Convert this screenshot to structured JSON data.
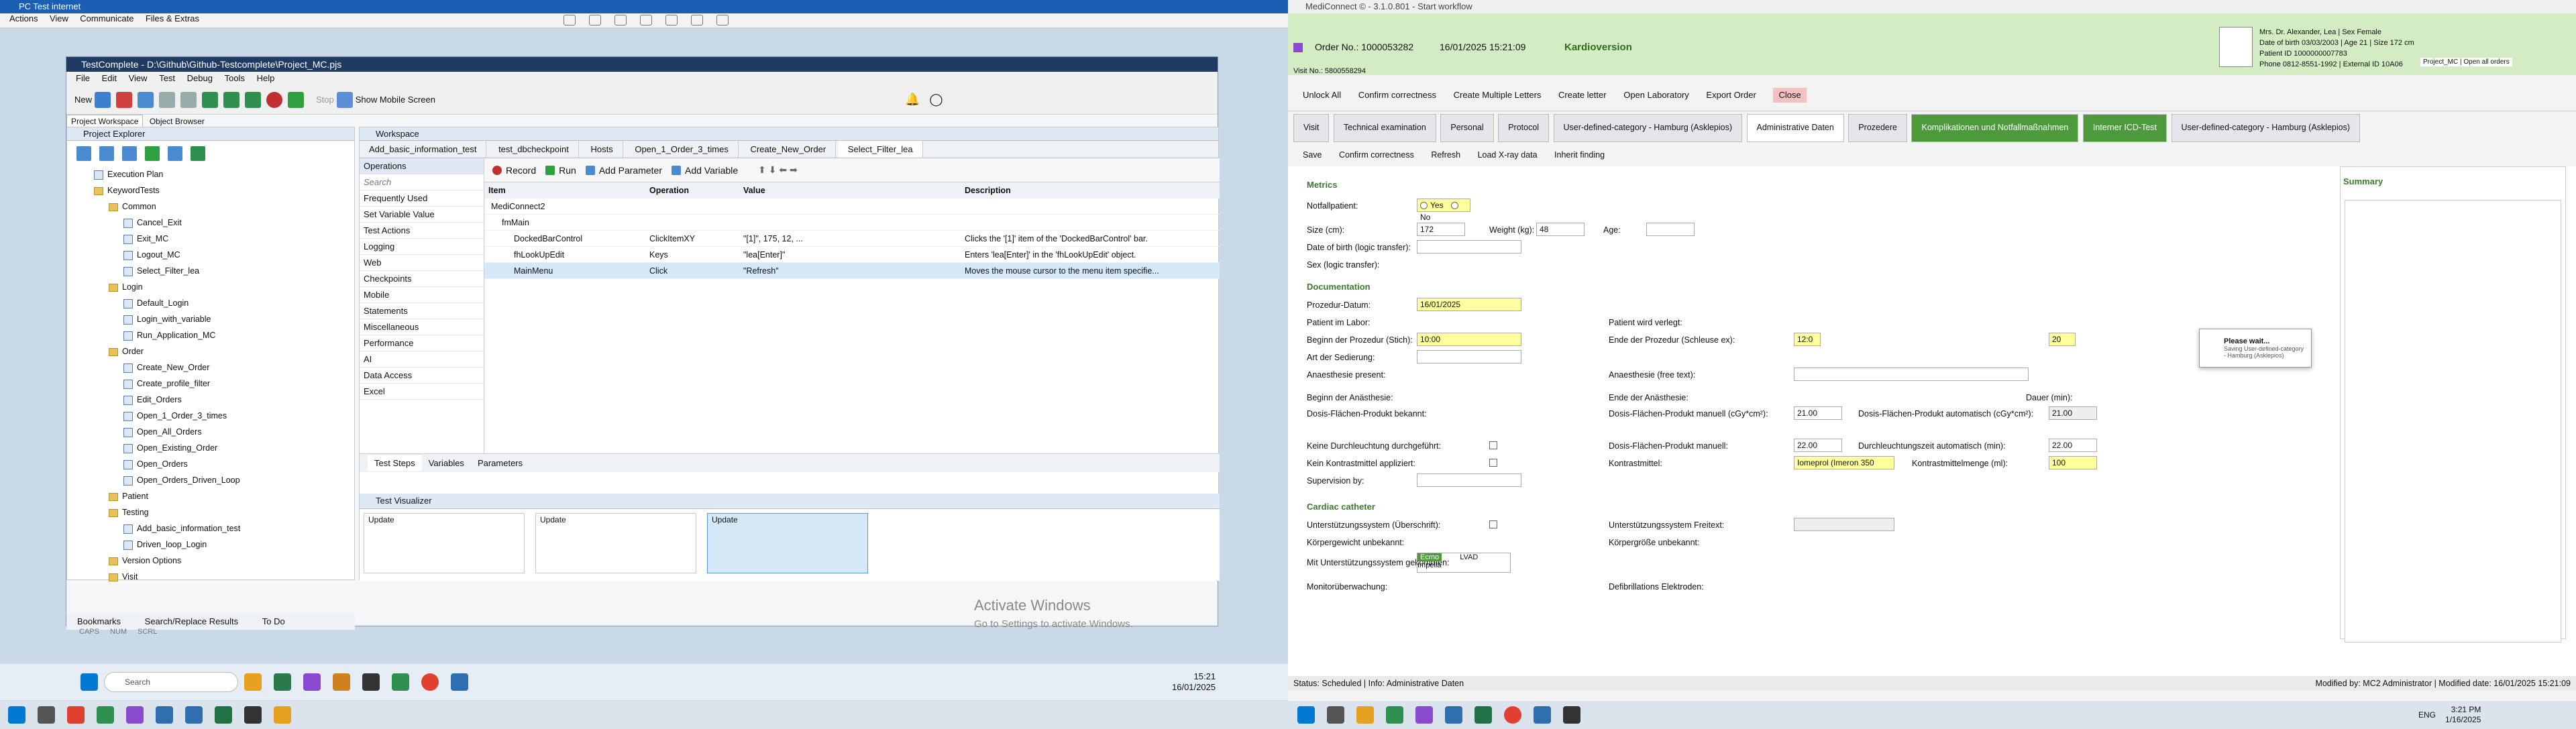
{
  "left": {
    "pc_title": "PC Test internet",
    "pc_menu": [
      "Actions",
      "View",
      "Communicate",
      "Files & Extras"
    ],
    "tc_title": "TestComplete - D:\\Github\\Github-Testcomplete\\Project_MC.pjs",
    "tc_menu": [
      "File",
      "Edit",
      "View",
      "Test",
      "Debug",
      "Tools",
      "Help"
    ],
    "toolbar": {
      "new": "New",
      "stop": "Stop",
      "mobile": "Show Mobile Screen"
    },
    "project_tabs": [
      "Project Workspace",
      "Object Browser"
    ],
    "project_explorer_title": "Project Explorer",
    "tree": [
      {
        "label": "Execution Plan",
        "indent": 0,
        "type": "tico"
      },
      {
        "label": "KeywordTests",
        "indent": 0,
        "type": "fico"
      },
      {
        "label": "Common",
        "indent": 1,
        "type": "fico"
      },
      {
        "label": "Cancel_Exit",
        "indent": 2,
        "type": "tico"
      },
      {
        "label": "Exit_MC",
        "indent": 2,
        "type": "tico"
      },
      {
        "label": "Logout_MC",
        "indent": 2,
        "type": "tico"
      },
      {
        "label": "Select_Filter_lea",
        "indent": 2,
        "type": "tico"
      },
      {
        "label": "Login",
        "indent": 1,
        "type": "fico"
      },
      {
        "label": "Default_Login",
        "indent": 2,
        "type": "tico"
      },
      {
        "label": "Login_with_variable",
        "indent": 2,
        "type": "tico"
      },
      {
        "label": "Run_Application_MC",
        "indent": 2,
        "type": "tico"
      },
      {
        "label": "Order",
        "indent": 1,
        "type": "fico"
      },
      {
        "label": "Create_New_Order",
        "indent": 2,
        "type": "tico"
      },
      {
        "label": "Create_profile_filter",
        "indent": 2,
        "type": "tico"
      },
      {
        "label": "Edit_Orders",
        "indent": 2,
        "type": "tico"
      },
      {
        "label": "Open_1_Order_3_times",
        "indent": 2,
        "type": "tico"
      },
      {
        "label": "Open_All_Orders",
        "indent": 2,
        "type": "tico"
      },
      {
        "label": "Open_Existing_Order",
        "indent": 2,
        "type": "tico"
      },
      {
        "label": "Open_Orders",
        "indent": 2,
        "type": "tico"
      },
      {
        "label": "Open_Orders_Driven_Loop",
        "indent": 2,
        "type": "tico"
      },
      {
        "label": "Patient",
        "indent": 1,
        "type": "fico"
      },
      {
        "label": "Testing",
        "indent": 1,
        "type": "fico"
      },
      {
        "label": "Add_basic_information_test",
        "indent": 2,
        "type": "tico"
      },
      {
        "label": "Driven_loop_Login",
        "indent": 2,
        "type": "tico"
      },
      {
        "label": "Version Options",
        "indent": 1,
        "type": "fico"
      },
      {
        "label": "Visit",
        "indent": 1,
        "type": "fico"
      }
    ],
    "workspace_title": "Workspace",
    "ws_tabs": [
      "Add_basic_information_test",
      "test_dbcheckpoint",
      "Hosts",
      "Open_1_Order_3_times",
      "Create_New_Order",
      "Select_Filter_lea"
    ],
    "ops_title": "Operations",
    "ops_search": "Search",
    "ops": [
      "Frequently Used",
      "Set Variable Value",
      "Test Actions",
      "Logging",
      "Web",
      "Checkpoints",
      "Mobile",
      "Statements",
      "Miscellaneous",
      "Performance",
      "AI",
      "Data Access",
      "Excel"
    ],
    "tv_buttons": [
      "Record",
      "Run",
      "Add Parameter",
      "Add Variable"
    ],
    "grid_headers": [
      "Item",
      "Operation",
      "Value",
      "Description"
    ],
    "grid_rows": [
      {
        "item": "MediConnect2",
        "op": "",
        "val": "",
        "desc": ""
      },
      {
        "item": "fmMain",
        "op": "",
        "val": "",
        "desc": ""
      },
      {
        "item": "DockedBarControl",
        "op": "ClickItemXY",
        "val": "\"[1]\", 175, 12, ...",
        "desc": "Clicks the '[1]' item of the 'DockedBarControl' bar."
      },
      {
        "item": "fhLookUpEdit",
        "op": "Keys",
        "val": "\"lea[Enter]\"",
        "desc": "Enters 'lea[Enter]' in the 'fhLookUpEdit' object."
      },
      {
        "item": "MainMenu",
        "op": "Click",
        "val": "\"Refresh\"",
        "desc": "Moves the mouse cursor to the menu item specifie..."
      }
    ],
    "bottom_ws_tabs": [
      "Test Steps",
      "Variables",
      "Parameters"
    ],
    "viz_title": "Test Visualizer",
    "viz_items": [
      "Update",
      "Update",
      "Update"
    ],
    "bottom_tabs": [
      "Bookmarks",
      "Search/Replace Results",
      "To Do"
    ],
    "status": [
      "CAPS",
      "NUM",
      "SCRL"
    ],
    "activate1": "Activate Windows",
    "activate2": "Go to Settings to activate Windows.",
    "search": "Search",
    "clock_time": "15:21",
    "clock_date": "16/01/2025"
  },
  "right": {
    "title": "MediConnect © - 3.1.0.801 - Start workflow",
    "order_no": "Order No.: 1000053282",
    "order_date": "16/01/2025 15:21:09",
    "order_type": "Kardioversion",
    "visit_no": "Visit No.: 5800558294",
    "patient_name": "Mrs. Dr. Alexander, Lea | Sex Female",
    "patient_dob": "Date of birth 03/03/2003 | Age 21 | Size 172 cm",
    "patient_id": "Patient ID 1000000007783",
    "patient_phone": "Phone 0812-8551-1992 | External ID 10A06",
    "project": "Project_MC | Open all orders",
    "toolbar": [
      "Unlock All",
      "Confirm correctness",
      "Create Multiple Letters",
      "Create letter",
      "Open Laboratory",
      "Export Order",
      "Close"
    ],
    "tabs": [
      "Visit",
      "Technical examination",
      "Personal",
      "Protocol",
      "User-defined-category - Hamburg (Asklepios)",
      "Administrative Daten",
      "Prozedere",
      "Komplikationen und Notfallmaßnahmen",
      "Interner ICD-Test",
      "User-defined-category - Hamburg (Asklepios)"
    ],
    "subtoolbar": [
      "Save",
      "Confirm correctness",
      "Refresh",
      "Load X-ray data",
      "Inherit finding"
    ],
    "metrics": "Metrics",
    "notfall": "Notfallpatient:",
    "yes": "Yes",
    "no": "No",
    "size_label": "Size (cm):",
    "size_val": "172",
    "weight_label": "Weight (kg):",
    "weight_val": "48",
    "age_label": "Age:",
    "dob_label": "Date of birth (logic transfer):",
    "sex_label": "Sex (logic transfer):",
    "documentation": "Documentation",
    "proz_datum": "Prozedur-Datum:",
    "proz_datum_val": "16/01/2025",
    "pat_labor": "Patient im Labor:",
    "pat_verlegt": "Patient wird verlegt:",
    "beginn": "Beginn der Prozedur (Stich):",
    "beginn_val": "10:00",
    "ende": "Ende der Prozedur (Schleuse ex):",
    "ende_val": "12:0",
    "ende_val2": "20",
    "sedierung": "Art der Sedierung:",
    "anaesthesie": "Anaesthesie present:",
    "anaesthesie_free": "Anaesthesie (free text):",
    "beginn_anae": "Beginn der Anästhesie:",
    "ende_anae": "Ende der Anästhesie:",
    "dauer": "Dauer (min):",
    "dosis_bekannt": "Dosis-Flächen-Produkt bekannt:",
    "dosis_manuell": "Dosis-Flächen-Produkt manuell (cGy*cm²):",
    "dosis_manuell_val": "21.00",
    "dosis_auto": "Dosis-Flächen-Produkt automatisch (cGy*cm²):",
    "dosis_auto_val": "21.00",
    "keine_durch": "Keine Durchleuchtung durchgeführt:",
    "dosis_manuell2": "Dosis-Flächen-Produkt manuell:",
    "dosis_manuell2_val": "22.00",
    "durch_auto": "Durchleuchtungszeit automatisch (min):",
    "durch_auto_val": "22.00",
    "kein_kontrast": "Kein Kontrastmittel appliziert:",
    "kontrast": "Kontrastmittel:",
    "kontrast_val": "Iomeprol (Imeron 350",
    "kontrast_menge": "Kontrastmittelmenge (ml):",
    "kontrast_menge_val": "100",
    "supervision": "Supervision by:",
    "cardiac": "Cardiac catheter",
    "unterst": "Unterstützungssystem (Überschrift):",
    "unterst_frei": "Unterstützungssystem Freitext:",
    "koerpergewicht": "Körpergewicht unbekannt:",
    "koerpergroesse": "Körpergröße unbekannt:",
    "mit_unterst": "Mit Unterstützungssystem gekommen:",
    "list_items": [
      "Ecmo",
      "LVAD",
      "Impella"
    ],
    "monitor": "Monitorüberwachung:",
    "defib": "Defibrillations Elektroden:",
    "summary": "Summary",
    "wait_title": "Please wait...",
    "wait_sub": "Saving User-defined-category - Hamburg (Asklepios)",
    "status_left": "Status: Scheduled | Info: Administrative Daten",
    "status_right": "Modified by: MC2 Administrator | Modified date: 16/01/2025 15:21:09",
    "clock_time": "3:21 PM",
    "clock_date": "1/16/2025",
    "lang": "ENG"
  },
  "colors": {
    "header_green": "#d4ecc4",
    "tab_green": "#4c9a3c",
    "yellow_field": "#ffffa0",
    "tc_title": "#1f3b63"
  }
}
